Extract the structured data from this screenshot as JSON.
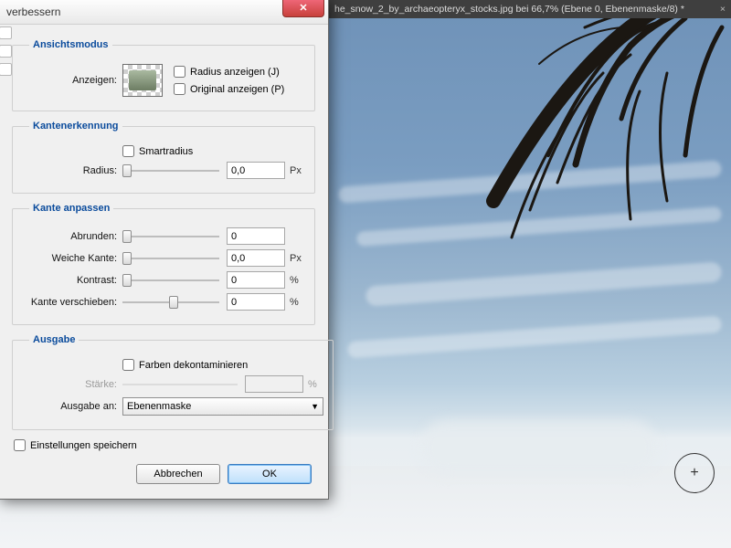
{
  "document_tab": {
    "label": "he_snow_2_by_archaeopteryx_stocks.jpg bei 66,7% (Ebene 0, Ebenenmaske/8) *"
  },
  "dialog": {
    "title": "verbessern",
    "sections": {
      "view": {
        "legend": "Ansichtsmodus",
        "show_label": "Anzeigen:",
        "show_radius": {
          "label": "Radius anzeigen (J)",
          "checked": false
        },
        "show_original": {
          "label": "Original anzeigen (P)",
          "checked": false
        }
      },
      "edge_detect": {
        "legend": "Kantenerkennung",
        "smart_radius": {
          "label": "Smartradius",
          "checked": false
        },
        "radius_label": "Radius:",
        "radius_value": "0,0",
        "radius_unit": "Px"
      },
      "edge_adjust": {
        "legend": "Kante anpassen",
        "smooth_label": "Abrunden:",
        "smooth_value": "0",
        "feather_label": "Weiche Kante:",
        "feather_value": "0,0",
        "feather_unit": "Px",
        "contrast_label": "Kontrast:",
        "contrast_value": "0",
        "contrast_unit": "%",
        "shift_label": "Kante verschieben:",
        "shift_value": "0",
        "shift_unit": "%"
      },
      "output": {
        "legend": "Ausgabe",
        "decontaminate": {
          "label": "Farben dekontaminieren",
          "checked": false
        },
        "amount_label": "Stärke:",
        "amount_value": "",
        "amount_unit": "%",
        "output_to_label": "Ausgabe an:",
        "output_to_value": "Ebenenmaske"
      }
    },
    "remember": {
      "label": "Einstellungen speichern",
      "checked": false
    },
    "buttons": {
      "cancel": "Abbrechen",
      "ok": "OK"
    }
  }
}
